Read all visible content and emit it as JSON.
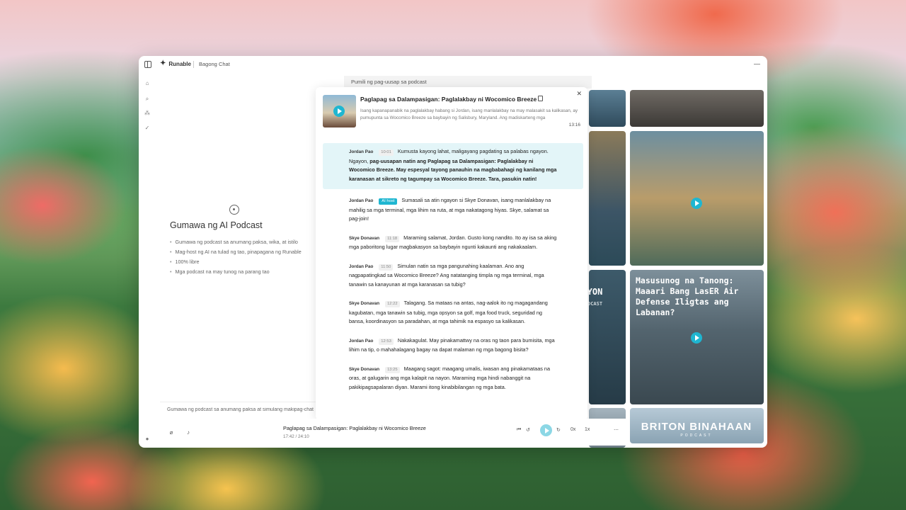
{
  "app": {
    "name": "Runable",
    "chat_title": "Bagong Chat"
  },
  "empty_state": {
    "title": "Gumawa ng AI Podcast",
    "features": [
      "Gumawa ng podcast sa anumang paksa, wika, at istilo",
      "Mag-host ng AI na tulad ng tao, pinapagana ng Runable",
      "100% libre",
      "Mga podcast na may tunog na parang tao"
    ]
  },
  "composer": {
    "placeholder": "Gumawa ng podcast sa anumang paksa at simulang makipag-chat"
  },
  "panel": {
    "header": "Pumili ng pag-uusap sa podcast"
  },
  "episode": {
    "title": "Paglapag sa Dalampasigan: Paglalakbay ni Wocomico Breeze",
    "description": "Isang kapanapanabik na paglalakbay habang si Jordan, isang manlalakbay na may malasakit sa kalikasan, ay pumupunta sa Wocomico Breeze sa baybayin ng Salisbury, Maryland. Ang madiskarteng mga",
    "duration": "13:16",
    "ai_badge": "AI host",
    "transcript": [
      {
        "speaker": "Jordan Pao",
        "time": "10:01",
        "text": "Kumusta kayong lahat, maligayang pagdating sa palabas ngayon. Ngayon, ",
        "bold": "pag-uusapan natin ang Paglapag sa Dalampasigan: Paglalakbay ni Wocomico Breeze. May espesyal tayong panauhin na magbabahagi ng kanilang mga karanasan at sikreto ng tagumpay sa Wocomico Breeze. Tara, pasukin natin!"
      },
      {
        "speaker": "Jordan Pao",
        "time": "",
        "text": "Sumasali sa atin ngayon si Skye Donavan, isang manlalakbay na mahilig sa mga terminal, mga lihim na ruta, at mga nakatagong hiyas. Skye, salamat sa pag-join!"
      },
      {
        "speaker": "Skye Donavan",
        "time": "11:18",
        "text": "Maraming salamat, Jordan. Gusto kong nandito. Ito ay isa sa aking mga paboritong lugar magbakasyon sa baybayin ngunti kakaunti ang nakakaalam."
      },
      {
        "speaker": "Jordan Pao",
        "time": "11:50",
        "text": "Simulan natin sa mga pangunahing kaalaman. Ano ang nagpapatingkad sa Wocomico Breeze? Ang natatanging timpla ng mga terminal, mga tanawin sa kanayunan at mga karanasan sa tubig?"
      },
      {
        "speaker": "Skye Donavan",
        "time": "12:22",
        "text": "Talagang. Sa mataas na antas, nag-aalok ito ng magagandang kagubatan, mga tanawin sa tubig, mga opsyon sa golf, mga food truck, seguridad ng bansa, koordinasyon sa paradahan, at mga tahimik na espasyo sa kalikasan."
      },
      {
        "speaker": "Jordan Pao",
        "time": "12:53",
        "text": "Nakakagulat. May pinakamattwy na oras ng taon para bumisita, mga lihim na tip, o mahahalagang bagay na dapat malaman ng mga bagong bisita?"
      },
      {
        "speaker": "Skye Donavan",
        "time": "13:25",
        "text": "Maagang sagot: maagang umalis, iwasan ang pinakamataas na oras, at galugarin ang mga kalapit na nayon. Maraming mga hindi nabanggit na pakikipagsapalaran diyan. Marami itong kinabibilangan ng mga bata."
      }
    ]
  },
  "player": {
    "title": "Paglapag sa Dalampasigan: Paglalakbay ni Wocomico Breeze",
    "time": "17:42 / 24:10",
    "speed_a": "0x",
    "speed_b": "1x"
  },
  "cards": {
    "card_question_title": "Masusunog na Tanong: Maaari Bang LasER Air Defense Iligtas ang Labanan?",
    "card_partial_text": "NGAYON",
    "card_partial_sub": "DCAST",
    "card_briton_title": "BRITON BINAHAAN",
    "card_briton_sub": "PODCAST"
  },
  "colors": {
    "accent": "#1fb6d1",
    "highlight": "#e3f5f8"
  }
}
